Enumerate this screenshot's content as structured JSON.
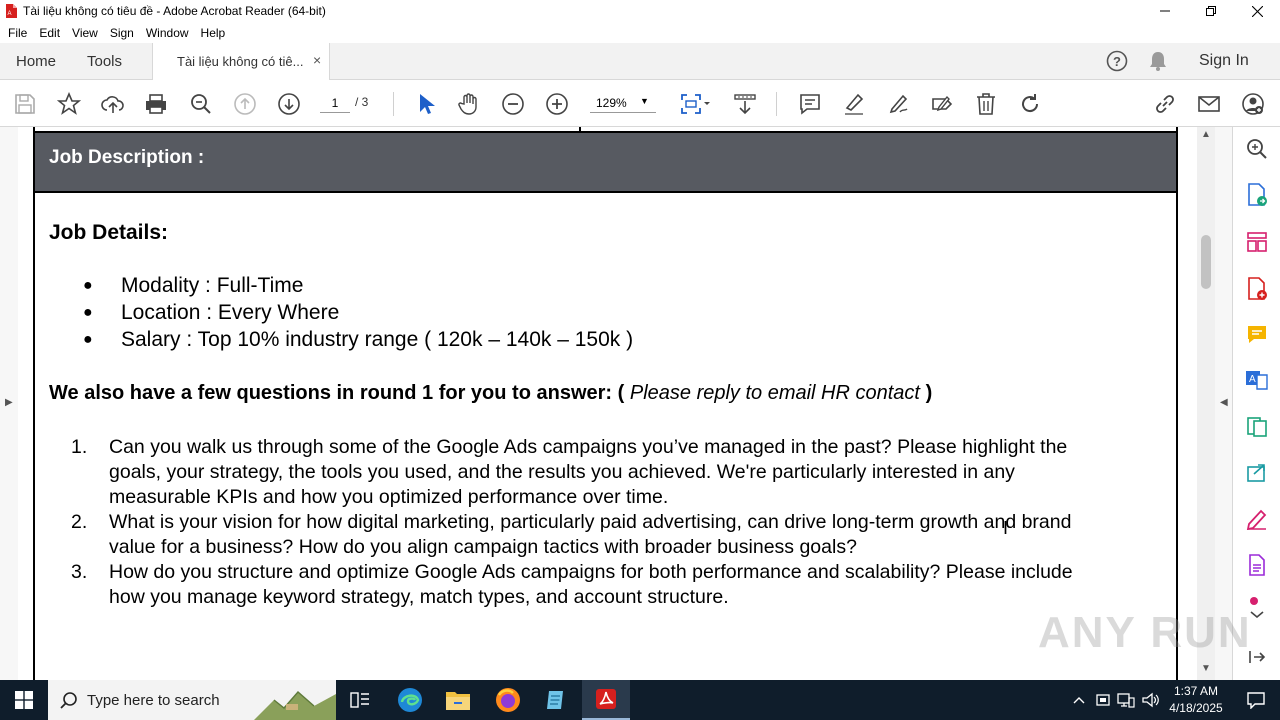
{
  "window": {
    "title": "Tài liệu không có tiêu đề - Adobe Acrobat Reader (64-bit)",
    "icon": "acrobat-pdf-icon"
  },
  "menu": [
    "File",
    "Edit",
    "View",
    "Sign",
    "Window",
    "Help"
  ],
  "tabs": {
    "home": "Home",
    "tools": "Tools",
    "document": "Tài liệu không có tiê...",
    "close": "×",
    "sign_in": "Sign In"
  },
  "toolbar": {
    "page_current": "1",
    "page_total": "/ 3",
    "zoom": "129%",
    "icons": [
      "save-icon",
      "star-icon",
      "upload-icon",
      "print-icon",
      "zoom-search-icon",
      "page-up-icon",
      "page-down-icon",
      "select-arrow-icon",
      "hand-icon",
      "zoom-out-icon",
      "zoom-in-icon",
      "fit-page-icon",
      "scroll-mode-icon",
      "comment-icon",
      "highlight-icon",
      "draw-icon",
      "fill-sign-icon",
      "delete-icon",
      "rotate-icon",
      "link-icon",
      "email-icon",
      "share-user-icon"
    ]
  },
  "document": {
    "band_title": "Job Description :",
    "details_heading": "Job Details:",
    "bullet_char": "●",
    "bullets": [
      "Modality : Full-Time",
      "Location : Every Where",
      "Salary : Top 10% industry range ( 120k – 140k – 150k )"
    ],
    "questions_intro_bold": "We also have a few questions in round 1 for you to answer: (",
    "questions_intro_italic": "Please reply to email HR contact",
    "questions_intro_close": ")",
    "questions": [
      {
        "num": "1.",
        "text": "Can you walk us through some of the Google Ads campaigns you’ve managed in the past? Please highlight the goals, your strategy, the tools you used, and the results you achieved. We're particularly interested in any measurable KPIs and how you optimized performance over time."
      },
      {
        "num": "2.",
        "text": "What is your vision for how digital marketing, particularly paid advertising, can drive long-term growth and brand value for a business? How do you align campaign tactics with broader business goals?"
      },
      {
        "num": "3.",
        "text": "How do you structure and optimize Google Ads campaigns for both performance and scalability? Please include how you manage keyword strategy, match types, and account structure."
      }
    ]
  },
  "right_rail_icons": [
    "search-zoom-icon",
    "export-pdf-icon",
    "organize-pages-icon",
    "create-pdf-icon",
    "comment-icon",
    "edit-pdf-icon",
    "combine-files-icon",
    "send-for-review-icon",
    "fill-sign-icon",
    "protect-icon",
    "more-tools-icon",
    "expand-icon"
  ],
  "watermark": "ANY RUN",
  "taskbar": {
    "search_placeholder": "Type here to search",
    "time": "1:37 AM",
    "date": "4/18/2025",
    "apps": [
      "task-view-icon",
      "edge-icon",
      "file-explorer-icon",
      "firefox-icon",
      "notepad-icon",
      "acrobat-icon"
    ]
  },
  "colors": {
    "band": "#575a61",
    "taskbar": "#0f1d2b",
    "acrobat_red": "#d6201e",
    "rail_icon_blue": "#2b6ed8"
  }
}
